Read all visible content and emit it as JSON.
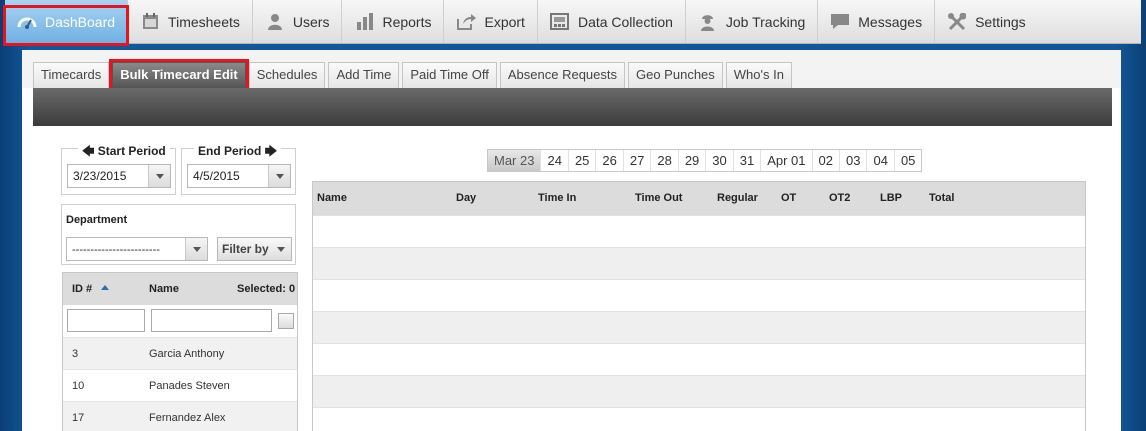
{
  "nav": [
    {
      "key": "dashboard",
      "label": "DashBoard",
      "icon": "dashboard-gauge-icon",
      "active": true
    },
    {
      "key": "timesheets",
      "label": "Timesheets",
      "icon": "calendar-icon"
    },
    {
      "key": "users",
      "label": "Users",
      "icon": "user-icon"
    },
    {
      "key": "reports",
      "label": "Reports",
      "icon": "bar-chart-icon"
    },
    {
      "key": "export",
      "label": "Export",
      "icon": "export-arrow-icon"
    },
    {
      "key": "data-collection",
      "label": "Data Collection",
      "icon": "terminal-icon"
    },
    {
      "key": "job-tracking",
      "label": "Job Tracking",
      "icon": "worker-icon"
    },
    {
      "key": "messages",
      "label": "Messages",
      "icon": "speech-bubble-icon"
    },
    {
      "key": "settings",
      "label": "Settings",
      "icon": "tools-icon"
    }
  ],
  "subtabs": [
    "Timecards",
    "Bulk Timecard Edit",
    "Schedules",
    "Add Time",
    "Paid Time Off",
    "Absence Requests",
    "Geo Punches",
    "Who's In"
  ],
  "active_subtab": "Bulk Timecard Edit",
  "period": {
    "start_label": "Start Period",
    "start_value": "3/23/2015",
    "end_label": "End Period",
    "end_value": "4/5/2015"
  },
  "department": {
    "label": "Department",
    "value": "------------------------",
    "filter_label": "Filter by"
  },
  "employees": {
    "col_id": "ID #",
    "col_name": "Name",
    "selected_label": "Selected: 0",
    "rows": [
      {
        "id": "3",
        "name": "Garcia Anthony"
      },
      {
        "id": "10",
        "name": "Panades Steven"
      },
      {
        "id": "17",
        "name": "Fernandez Alex"
      }
    ]
  },
  "dates": [
    "Mar 23",
    "24",
    "25",
    "26",
    "27",
    "28",
    "29",
    "30",
    "31",
    "Apr 01",
    "02",
    "03",
    "04",
    "05"
  ],
  "grid_columns": [
    "Name",
    "Day",
    "Time In",
    "Time Out",
    "Regular",
    "OT",
    "OT2",
    "LBP",
    "Total"
  ],
  "colors": {
    "highlight": "#e5141f",
    "nav_active": "#6fb0e3",
    "page_bg": "#12579a"
  }
}
